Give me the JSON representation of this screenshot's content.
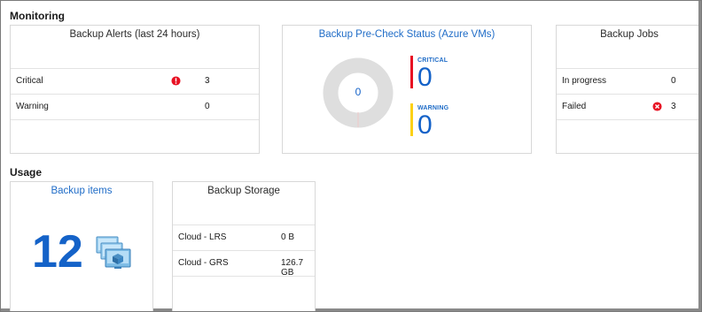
{
  "monitoring": {
    "title": "Monitoring",
    "alerts": {
      "title": "Backup Alerts (last 24 hours)",
      "rows": [
        {
          "label": "Critical",
          "value": "3"
        },
        {
          "label": "Warning",
          "value": "0"
        }
      ]
    },
    "precheck": {
      "title": "Backup Pre-Check Status (Azure VMs)",
      "total": "0",
      "critical_label": "CRITICAL",
      "critical_value": "0",
      "warning_label": "WARNING",
      "warning_value": "0",
      "critical_color": "#e81123",
      "warning_color": "#fcd116"
    },
    "jobs": {
      "title": "Backup Jobs",
      "rows": [
        {
          "label": "In progress",
          "value": "0"
        },
        {
          "label": "Failed",
          "value": "3"
        }
      ]
    }
  },
  "usage": {
    "title": "Usage",
    "items": {
      "title": "Backup items",
      "count": "12"
    },
    "storage": {
      "title": "Backup Storage",
      "rows": [
        {
          "label": "Cloud - LRS",
          "value": "0 B"
        },
        {
          "label": "Cloud - GRS",
          "value": "126.7 GB"
        }
      ]
    }
  }
}
